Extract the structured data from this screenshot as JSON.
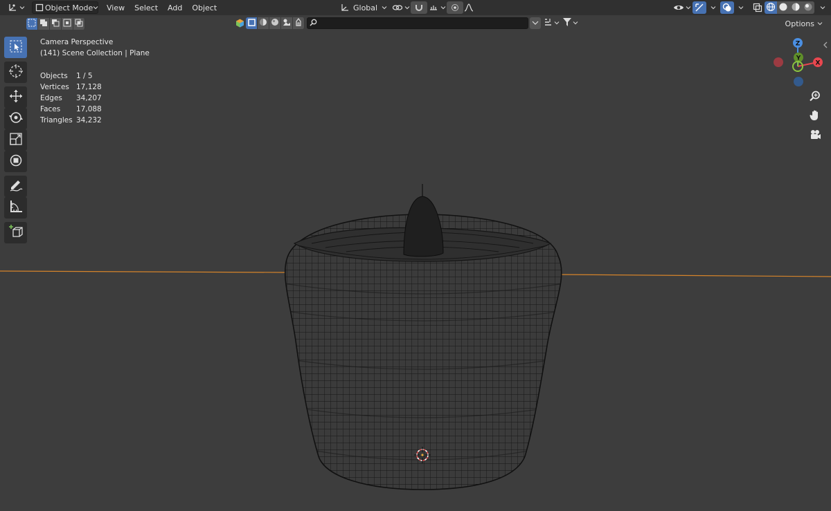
{
  "header": {
    "editor_type_icon": "3d-viewport-icon",
    "mode": "Object Mode",
    "menus": [
      "View",
      "Select",
      "Add",
      "Object"
    ],
    "transform_orientation": "Global",
    "right_icons": [
      "visibility-icon",
      "gizmo-icon",
      "overlay-icon",
      "xray-icon",
      "wireframe-shading",
      "solid-shading",
      "material-shading",
      "rendered-shading"
    ]
  },
  "subbar": {
    "search": {
      "value": "",
      "placeholder": ""
    },
    "options_label": "Options"
  },
  "toolbar": {
    "tools": [
      "select-box",
      "cursor",
      "move",
      "rotate",
      "scale",
      "transform",
      "annotate",
      "measure",
      "add-cube"
    ],
    "active": "select-box"
  },
  "overlay": {
    "view_name": "Camera Perspective",
    "collection": "(141) Scene Collection | Plane",
    "stats": [
      {
        "label": "Objects",
        "value": "1 / 5"
      },
      {
        "label": "Vertices",
        "value": "17,128"
      },
      {
        "label": "Edges",
        "value": "34,207"
      },
      {
        "label": "Faces",
        "value": "17,088"
      },
      {
        "label": "Triangles",
        "value": "34,232"
      }
    ]
  },
  "gizmo": {
    "z": "Z",
    "y": "Y",
    "x": "X"
  },
  "colors": {
    "accent": "#4772b3",
    "background": "#3d3d3d",
    "header": "#303030",
    "x_axis": "#e8474f",
    "y_axis": "#8bc53f",
    "z_axis": "#4b8fe2",
    "horizon": "#d6842a"
  }
}
